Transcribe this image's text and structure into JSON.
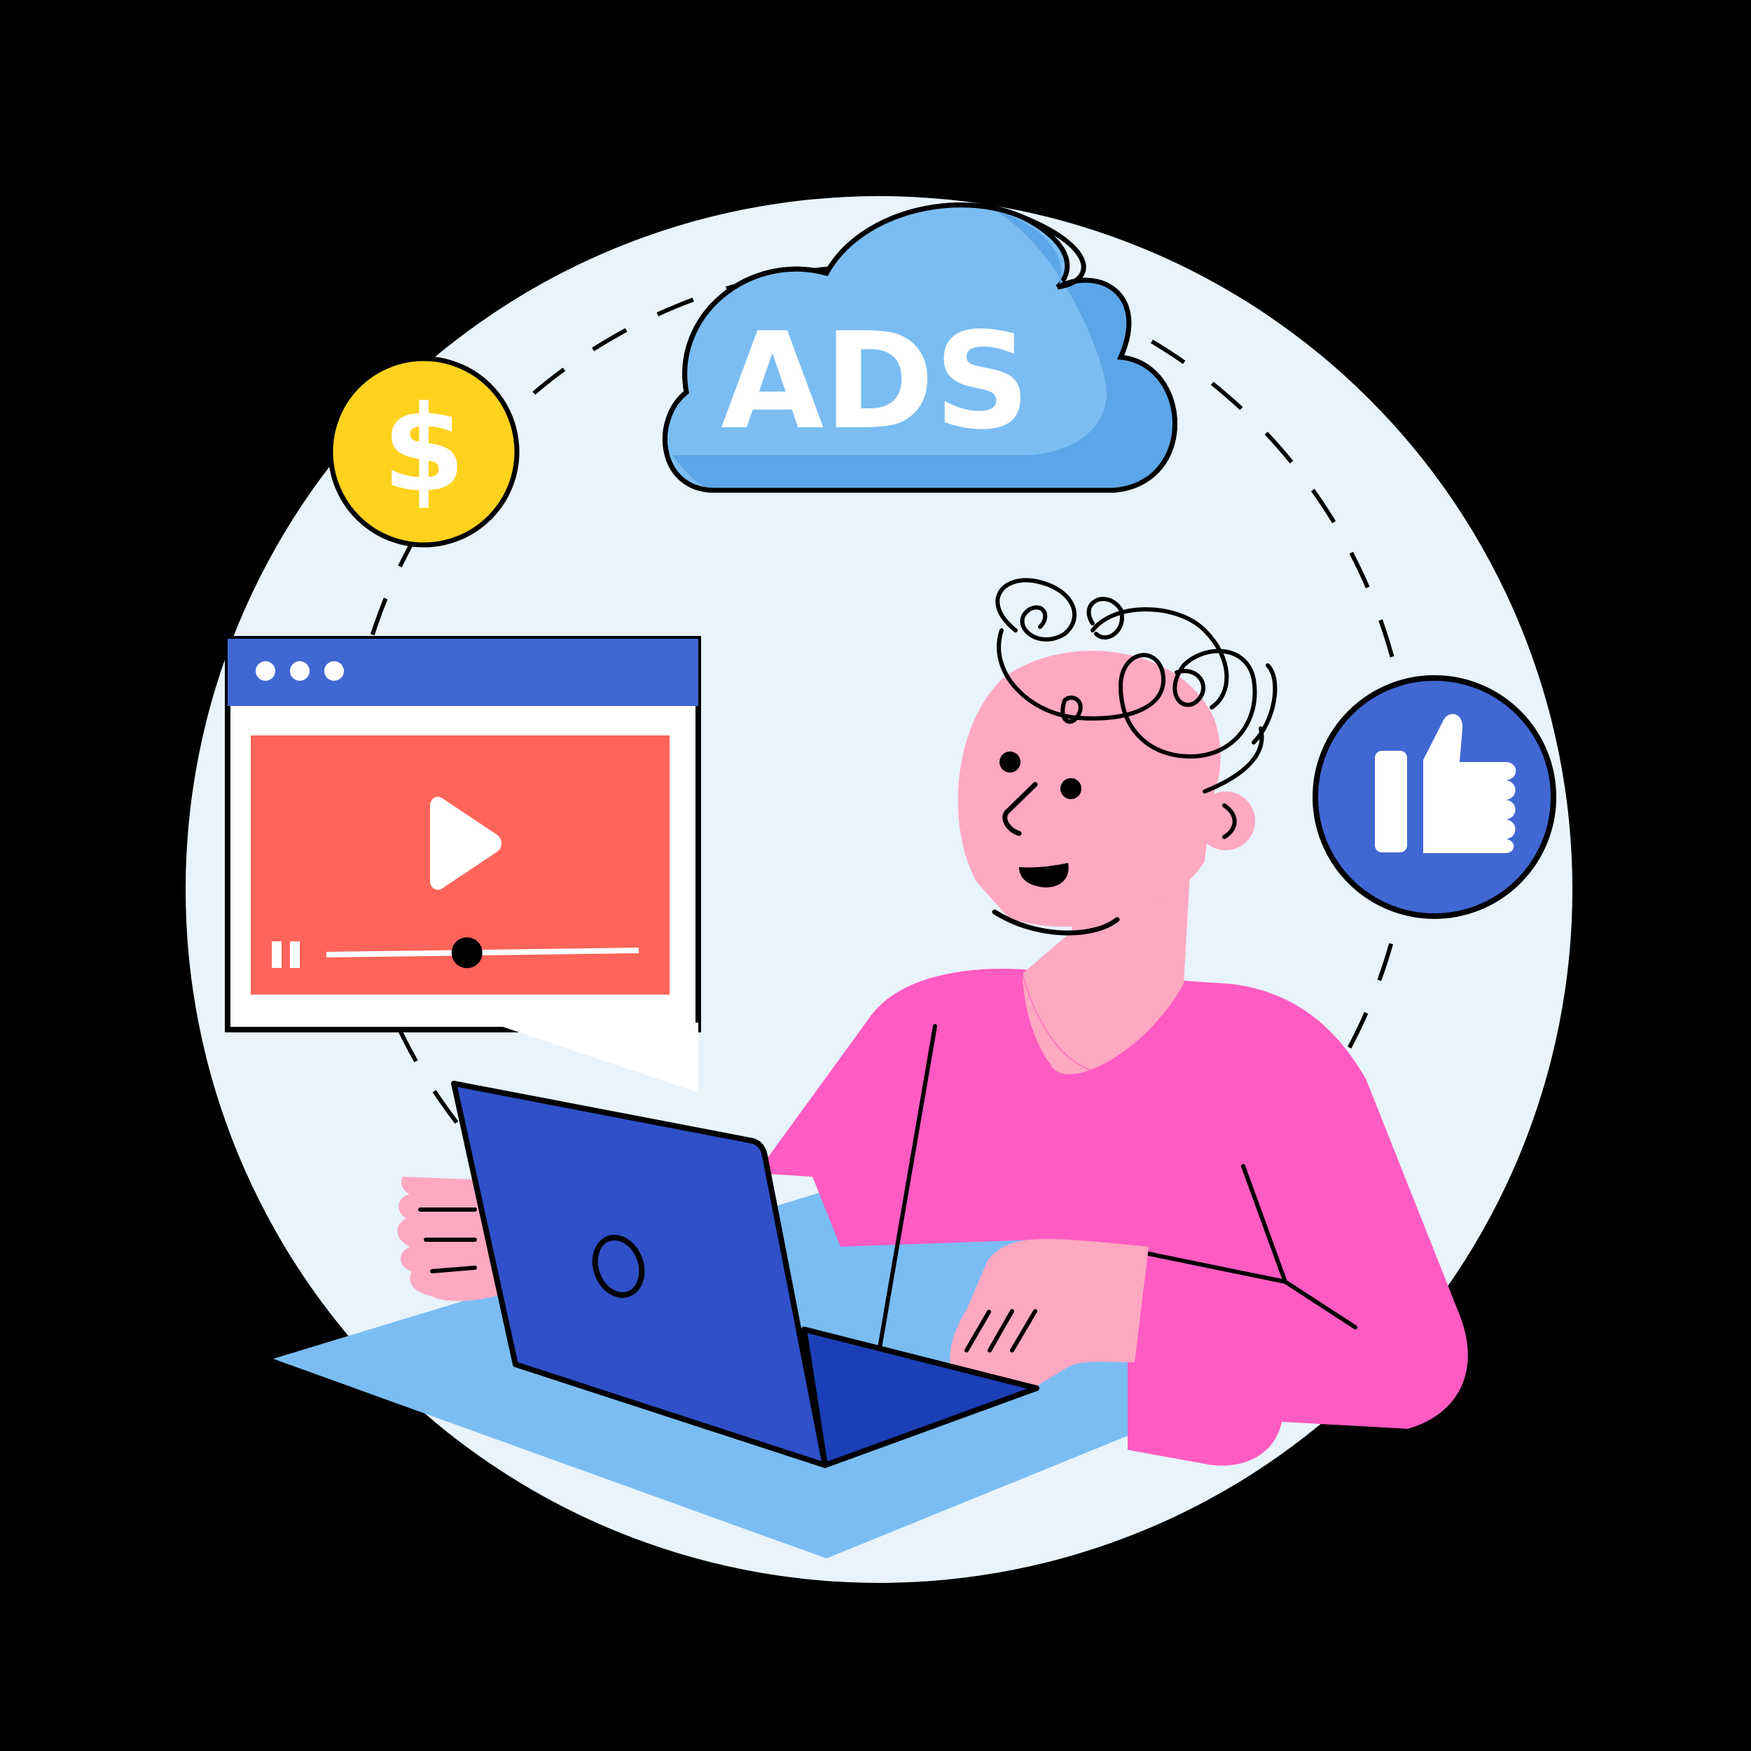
{
  "illustration": {
    "cloud": {
      "label": "ADS"
    },
    "coin": {
      "symbol": "$"
    },
    "video_player": {
      "progress": 0.45
    },
    "colors": {
      "background": "#000000",
      "circle": "#E8F3FC",
      "cloud": "#7BBDF3",
      "cloud_shade": "#5BA6E8",
      "coin": "#FFD21E",
      "like_badge": "#4167D3",
      "browser_bar": "#4167D3",
      "video": "#FF645A",
      "shirt": "#FF5BC2",
      "skin": "#FFA8C2",
      "laptop": "#2F50C9",
      "desk": "#7BBDF3"
    }
  }
}
